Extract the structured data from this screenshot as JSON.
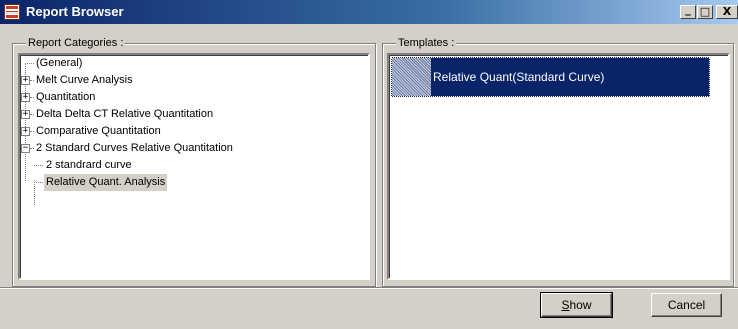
{
  "window": {
    "title": "Report Browser",
    "controls": {
      "minimize": "_",
      "maximize": "□",
      "close": "X"
    }
  },
  "categories": {
    "label": "Report Categories :",
    "items": [
      {
        "label": "(General)",
        "expander": ""
      },
      {
        "label": "Melt Curve Analysis",
        "expander": "+"
      },
      {
        "label": "Quantitation",
        "expander": "+"
      },
      {
        "label": "Delta Delta CT Relative Quantitation",
        "expander": "+"
      },
      {
        "label": "Comparative Quantitation",
        "expander": "+"
      },
      {
        "label": "2 Standard Curves Relative Quantitation",
        "expander": "−",
        "children": [
          {
            "label": "2 standrard curve"
          },
          {
            "label": "Relative Quant. Analysis",
            "selected": true
          }
        ]
      }
    ]
  },
  "templates": {
    "label": "Templates :",
    "items": [
      {
        "label": "Relative Quant(Standard Curve)",
        "selected": true
      }
    ]
  },
  "buttons": {
    "show_first": "S",
    "show_rest": "how",
    "cancel": "Cancel"
  }
}
